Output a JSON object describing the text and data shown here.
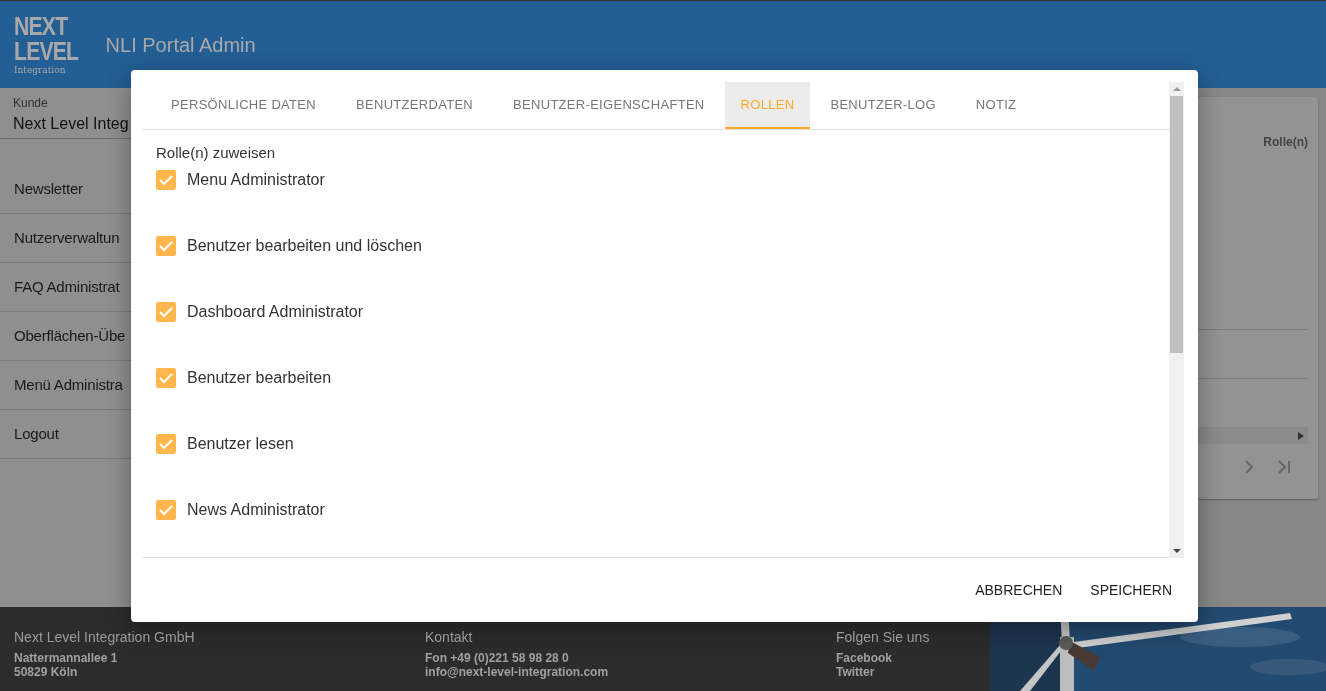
{
  "header": {
    "logo": [
      "NEXT",
      "LEVEL",
      "Integration"
    ],
    "title": "NLI Portal Admin"
  },
  "sidebar": {
    "customer_label": "Kunde",
    "customer_value": "Next Level Integ",
    "items": [
      {
        "label": "Newsletter"
      },
      {
        "label": "Nutzerverwaltun"
      },
      {
        "label": "FAQ Administrat"
      },
      {
        "label": "Oberflächen-Übe"
      },
      {
        "label": "Menü Administra"
      },
      {
        "label": "Logout"
      }
    ]
  },
  "background_card": {
    "column_header": "Rolle(n)"
  },
  "dialog": {
    "tabs": [
      {
        "label": "PERSÖNLICHE DATEN",
        "selected": false
      },
      {
        "label": "BENUTZERDATEN",
        "selected": false
      },
      {
        "label": "BENUTZER-EIGENSCHAFTEN",
        "selected": false
      },
      {
        "label": "ROLLEN",
        "selected": true
      },
      {
        "label": "BENUTZER-LOG",
        "selected": false
      },
      {
        "label": "NOTIZ",
        "selected": false
      }
    ],
    "section_label": "Rolle(n) zuweisen",
    "roles": [
      {
        "label": "Menu Administrator",
        "checked": true
      },
      {
        "label": "Benutzer bearbeiten und löschen",
        "checked": true
      },
      {
        "label": "Dashboard Administrator",
        "checked": true
      },
      {
        "label": "Benutzer bearbeiten",
        "checked": true
      },
      {
        "label": "Benutzer lesen",
        "checked": true
      },
      {
        "label": "News Administrator",
        "checked": true
      }
    ],
    "buttons": [
      "ABBRECHEN",
      "SPEICHERN"
    ]
  },
  "footer": {
    "columns": [
      {
        "heading": "Next Level Integration GmbH",
        "lines": [
          "Nattermannallee 1",
          "50829 Köln"
        ]
      },
      {
        "heading": "Kontakt",
        "lines": [
          "Fon +49 (0)221 58 98 28 0",
          "info@next-level-integration.com"
        ]
      },
      {
        "heading": "Folgen Sie uns",
        "lines": [
          "Facebook",
          "Twitter"
        ]
      }
    ]
  }
}
